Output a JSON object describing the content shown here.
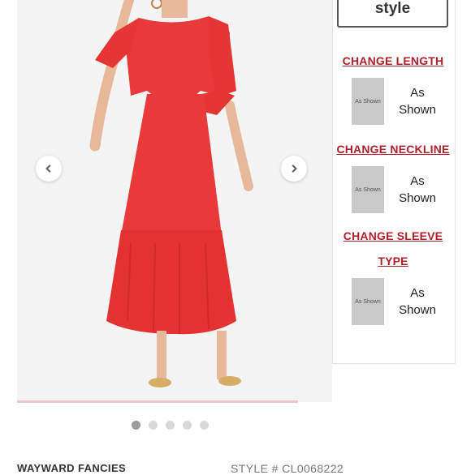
{
  "gallery": {
    "image_alt": "Red dress model",
    "dot_count": 5,
    "active_dot_index": 0
  },
  "customize": {
    "style_button": "style",
    "options": [
      {
        "title": "CHANGE LENGTH",
        "swatch_text": "As Shown",
        "value": "As Shown"
      },
      {
        "title": "CHANGE NECKLINE",
        "swatch_text": "As Shown",
        "value": "As Shown"
      },
      {
        "title_line1": "CHANGE SLEEVE",
        "title_line2": "TYPE",
        "swatch_text": "As Shown",
        "value": "As Shown"
      }
    ]
  },
  "product": {
    "brand": "WAYWARD FANCIES",
    "style_number": "STYLE # CL0068222"
  },
  "colors": {
    "accent": "#b0202a",
    "dress": "#e83a3a"
  }
}
